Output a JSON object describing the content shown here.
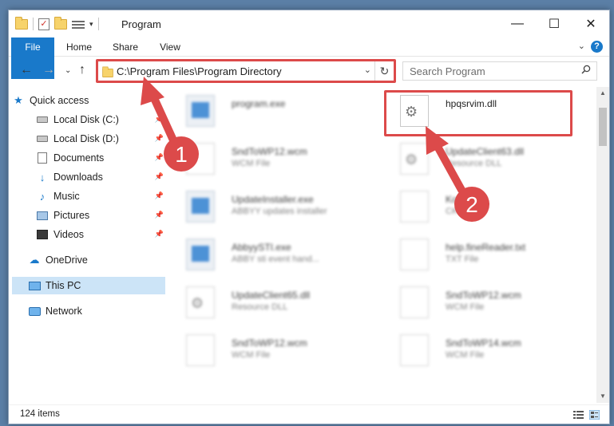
{
  "window": {
    "title": "Program",
    "controls": {
      "minimize": "—",
      "maximize": "☐",
      "close": "✕"
    }
  },
  "ribbon": {
    "tabs": [
      "File",
      "Home",
      "Share",
      "View"
    ]
  },
  "address_bar": {
    "path": "C:\\Program Files\\Program Directory",
    "search_placeholder": "Search Program"
  },
  "sidebar": {
    "items": [
      {
        "label": "Quick access",
        "icon": "star-icon",
        "pinned": false
      },
      {
        "label": "Local Disk (C:)",
        "icon": "drive-icon",
        "pinned": true
      },
      {
        "label": "Local Disk (D:)",
        "icon": "drive-icon",
        "pinned": true
      },
      {
        "label": "Documents",
        "icon": "documents-icon",
        "pinned": true
      },
      {
        "label": "Downloads",
        "icon": "downloads-icon",
        "pinned": true
      },
      {
        "label": "Music",
        "icon": "music-icon",
        "pinned": true
      },
      {
        "label": "Pictures",
        "icon": "pictures-icon",
        "pinned": true
      },
      {
        "label": "Videos",
        "icon": "videos-icon",
        "pinned": true
      },
      {
        "label": "OneDrive",
        "icon": "onedrive-icon",
        "pinned": false
      },
      {
        "label": "This PC",
        "icon": "pc-icon",
        "pinned": false,
        "selected": true
      },
      {
        "label": "Network",
        "icon": "network-icon",
        "pinned": false
      }
    ]
  },
  "files": [
    {
      "name": "program.exe",
      "type": "",
      "icon": "exe-icon"
    },
    {
      "name": "hpqsrvim.dll",
      "type": "",
      "icon": "dll-icon",
      "highlighted": true
    },
    {
      "name": "SndToWP12.wcm",
      "type": "WCM File",
      "icon": "file-icon"
    },
    {
      "name": "UpdateClient63.dll",
      "type": "Resource DLL",
      "icon": "dll-icon"
    },
    {
      "name": "UpdateInstaller.exe",
      "type": "ABBYY updates installer",
      "icon": "exe-icon"
    },
    {
      "name": "Korean",
      "type": "CK File",
      "icon": "file-icon"
    },
    {
      "name": "AbbyySTI.exe",
      "type": "ABBY sti event hand...",
      "icon": "exe-icon"
    },
    {
      "name": "help.fineReader.txt",
      "type": "TXT File",
      "icon": "file-icon"
    },
    {
      "name": "UpdateClient65.dll",
      "type": "Resource DLL",
      "icon": "dll-icon"
    },
    {
      "name": "SndToWP12.wcm",
      "type": "WCM File",
      "icon": "file-icon"
    },
    {
      "name": "SndToWP12.wcm",
      "type": "WCM File",
      "icon": "file-icon"
    },
    {
      "name": "SndToWP14.wcm",
      "type": "WCM File",
      "icon": "file-icon"
    }
  ],
  "status": {
    "item_count": "124 items"
  },
  "annotations": {
    "step1": "1",
    "step2": "2",
    "color": "#dc4a4a"
  }
}
